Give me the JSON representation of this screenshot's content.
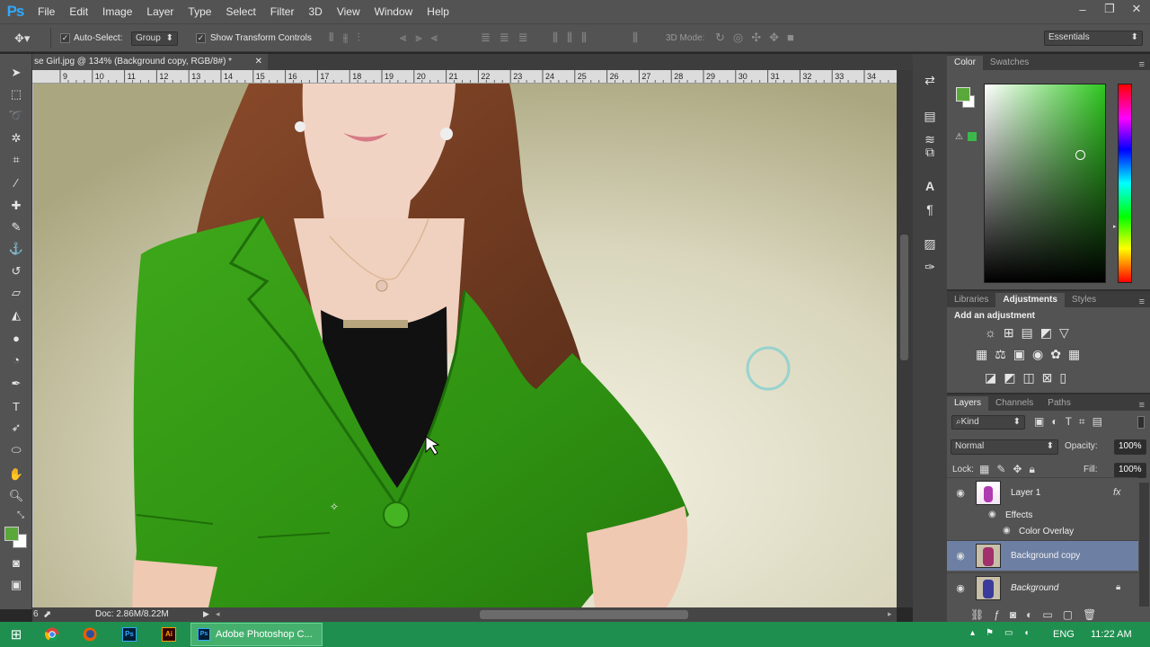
{
  "app": {
    "logo": "Ps"
  },
  "menu": [
    "File",
    "Edit",
    "Image",
    "Layer",
    "Type",
    "Select",
    "Filter",
    "3D",
    "View",
    "Window",
    "Help"
  ],
  "window_controls": {
    "minimize": "‒",
    "restore": "❐",
    "close": "✕"
  },
  "options": {
    "auto_select_label": "Auto-Select:",
    "auto_select_value": "Group",
    "show_transform_label": "Show Transform Controls",
    "mode_3d_label": "3D Mode:",
    "workspace": "Essentials"
  },
  "document": {
    "tab_title": "se Girl.jpg @ 134% (Background copy, RGB/8#) *",
    "ruler_ticks": [
      "9",
      "10",
      "11",
      "12",
      "13",
      "14",
      "15",
      "16",
      "17",
      "18",
      "19",
      "20",
      "21",
      "22",
      "23",
      "24",
      "25",
      "26",
      "27",
      "28",
      "29",
      "30",
      "31",
      "32",
      "33",
      "34"
    ],
    "status": "Doc: 2.86M/8.22M",
    "zoom_hint": "6"
  },
  "color_panel": {
    "tabs": [
      "Color",
      "Swatches"
    ],
    "foreground": "#5aa83a",
    "background": "#ffffff",
    "hue": "#3ad43a"
  },
  "adjustments_panel": {
    "tabs": [
      "Libraries",
      "Adjustments",
      "Styles"
    ],
    "heading": "Add an adjustment"
  },
  "layers_panel": {
    "tabs": [
      "Layers",
      "Channels",
      "Paths"
    ],
    "filter_kind": "Kind",
    "blend_mode": "Normal",
    "opacity_label": "Opacity:",
    "opacity_value": "100%",
    "lock_label": "Lock:",
    "fill_label": "Fill:",
    "fill_value": "100%",
    "layers": [
      {
        "name": "Layer 1",
        "fx": "fx",
        "selected": false
      },
      {
        "name": "Background copy",
        "selected": true
      },
      {
        "name": "Background",
        "selected": false
      }
    ],
    "effects_label": "Effects",
    "color_overlay_label": "Color Overlay"
  },
  "taskbar": {
    "active_task": "Adobe Photoshop C...",
    "language": "ENG",
    "time": "11:22 AM"
  }
}
